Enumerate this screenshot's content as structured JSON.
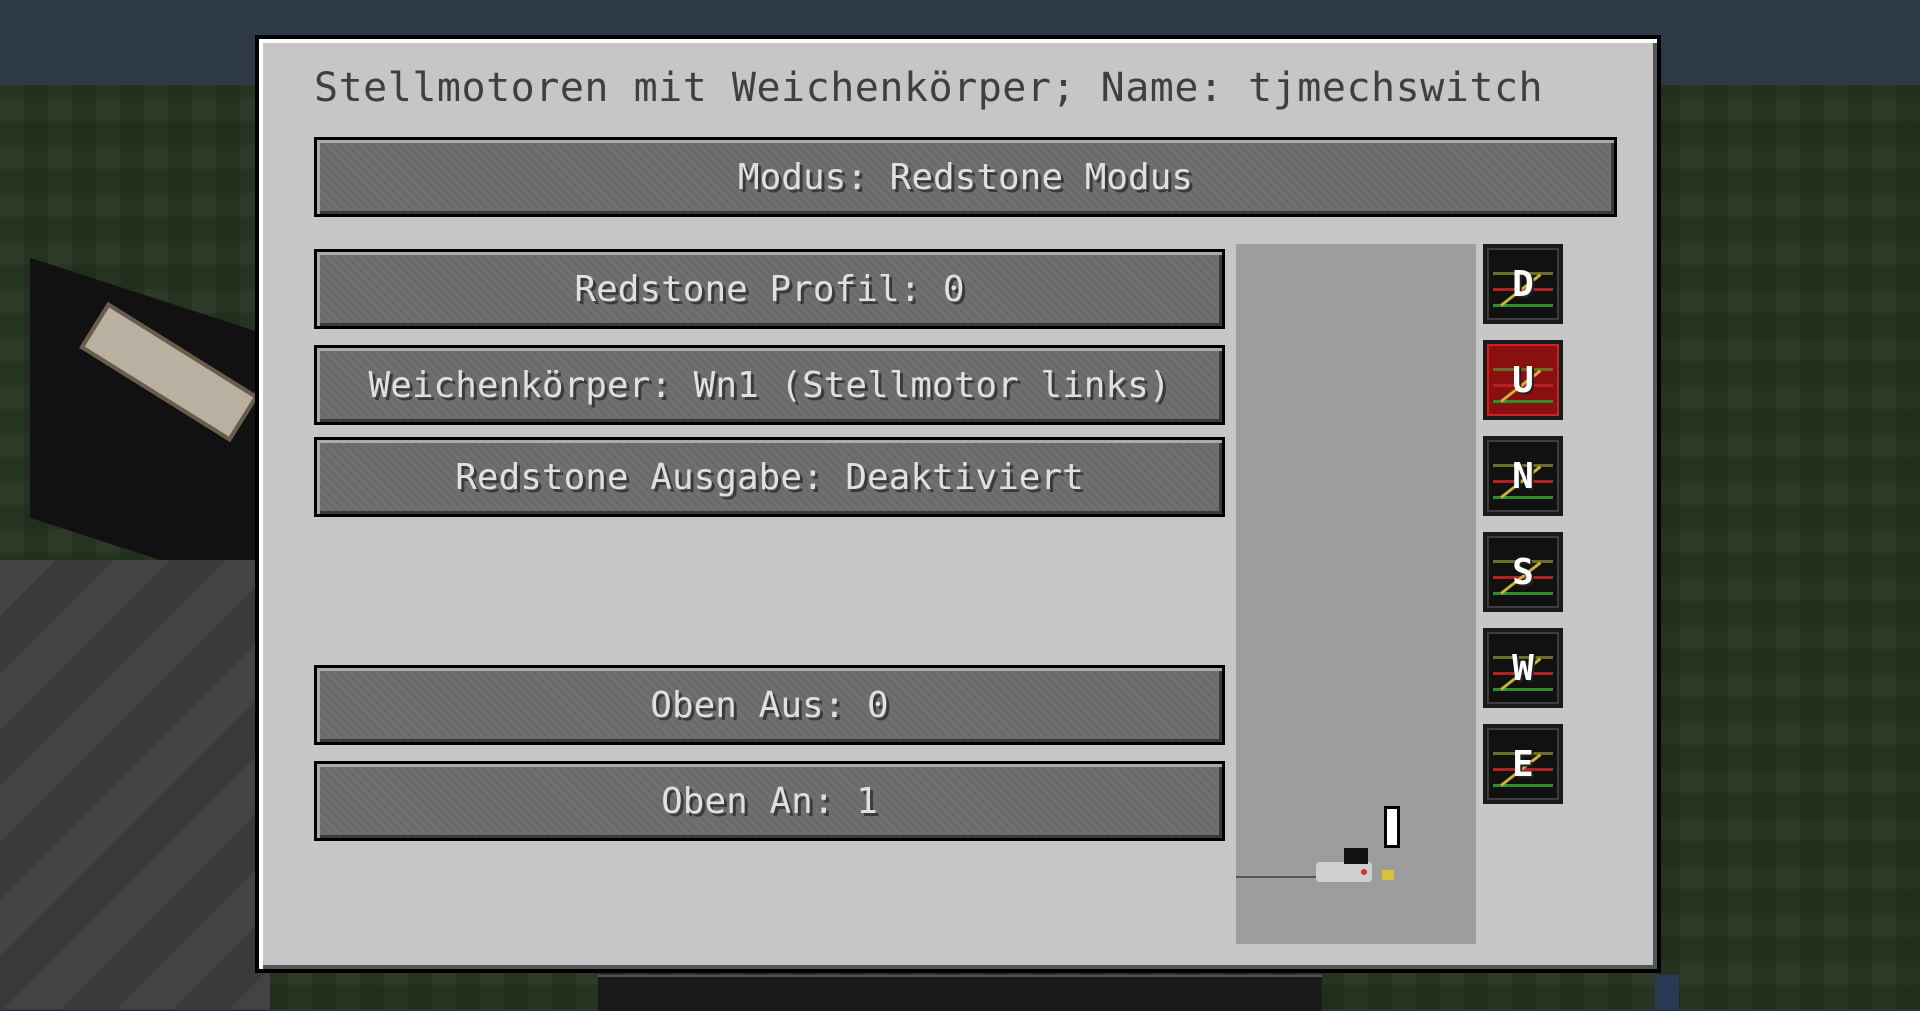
{
  "window": {
    "title": "Stellmotoren mit Weichenkörper; Name: tjmechswitch"
  },
  "buttons": {
    "mode": "Modus: Redstone Modus",
    "redstone_profile": "Redstone Profil: 0",
    "switch_body": "Weichenkörper: Wn1 (Stellmotor links)",
    "redstone_output": "Redstone Ausgabe: Deaktiviert",
    "top_off": "Oben Aus: 0",
    "top_on": "Oben An: 1"
  },
  "sides": [
    {
      "letter": "D",
      "active": false
    },
    {
      "letter": "U",
      "active": true
    },
    {
      "letter": "N",
      "active": false
    },
    {
      "letter": "S",
      "active": false
    },
    {
      "letter": "W",
      "active": false
    },
    {
      "letter": "E",
      "active": false
    }
  ],
  "colors": {
    "panel": "#c6c6c6",
    "button": "#6e6e6e",
    "button_text": "#e0e0e0",
    "active_side": "#8a0f0f"
  }
}
